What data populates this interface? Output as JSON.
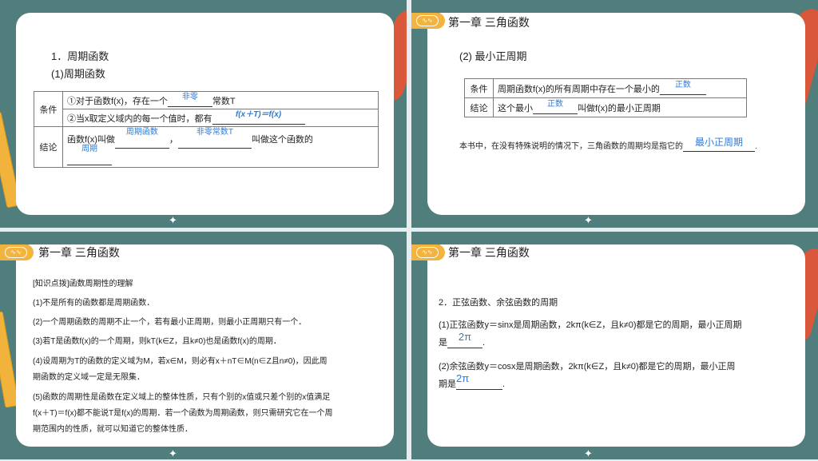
{
  "chapter_title": "第一章 三角函数",
  "slide1": {
    "heading": "1．周期函数",
    "subheading": "(1)周期函数",
    "row1_label": "条件",
    "row1a_prefix": "①对于函数f(x)，存在一个",
    "row1a_answer": "非零",
    "row1a_suffix": "常数T",
    "row1b_prefix": "②当x取定义域内的每一个值时，都有",
    "row1b_answer": "f(x＋T)＝f(x)",
    "row2_label": "结论",
    "row2_prefix": "函数f(x)叫做",
    "row2_answer1": "周期函数",
    "row2_sep": "，",
    "row2_answer2": "非零常数T",
    "row2_mid": "叫做这个函数的",
    "row2_answer3": "周期"
  },
  "slide2": {
    "heading": "(2) 最小正周期",
    "row1_label": "条件",
    "row1_prefix": "周期函数f(x)的所有周期中存在一个最小的",
    "row1_answer": "正数",
    "row2_label": "结论",
    "row2_prefix": "这个最小",
    "row2_answer": "正数",
    "row2_suffix": "叫做f(x)的最小正周期",
    "note_prefix": "本书中，在没有特殊说明的情况下，三角函数的周期均是指它的",
    "note_answer": "最小正周期",
    "note_suffix": "."
  },
  "slide3": {
    "title": "[知识点拨]函数周期性的理解",
    "items": [
      "(1)不是所有的函数都是周期函数．",
      "(2)一个周期函数的周期不止一个，若有最小正周期，则最小正周期只有一个．",
      "(3)若T是函数f(x)的一个周期，则kT(k∈Z，且k≠0)也是函数f(x)的周期．",
      "(4)设周期为T的函数的定义域为M，若x∈M，则必有x＋nT∈M(n∈Z且n≠0)，因此周",
      "期函数的定义域一定是无限集．",
      "(5)函数的周期性是函数在定义域上的整体性质，只有个别的x值或只差个别的x值满足",
      "f(x＋T)＝f(x)都不能说T是f(x)的周期．若一个函数为周期函数，则只需研究它在一个周",
      "期范围内的性质，就可以知道它的整体性质．"
    ]
  },
  "slide4": {
    "heading": "2．正弦函数、余弦函数的周期",
    "p1_line1": "(1)正弦函数y＝sinx是周期函数，2kπ(k∈Z，且k≠0)都是它的周期，最小正周期",
    "p1_line2_prefix": "是",
    "p1_answer": "2π",
    "p1_suffix": ".",
    "p2_line1": "(2)余弦函数y＝cosx是周期函数，2kπ(k∈Z，且k≠0)都是它的周期，最小正周",
    "p2_line2_prefix": "期是",
    "p2_answer": "2π",
    "p2_suffix": "."
  }
}
